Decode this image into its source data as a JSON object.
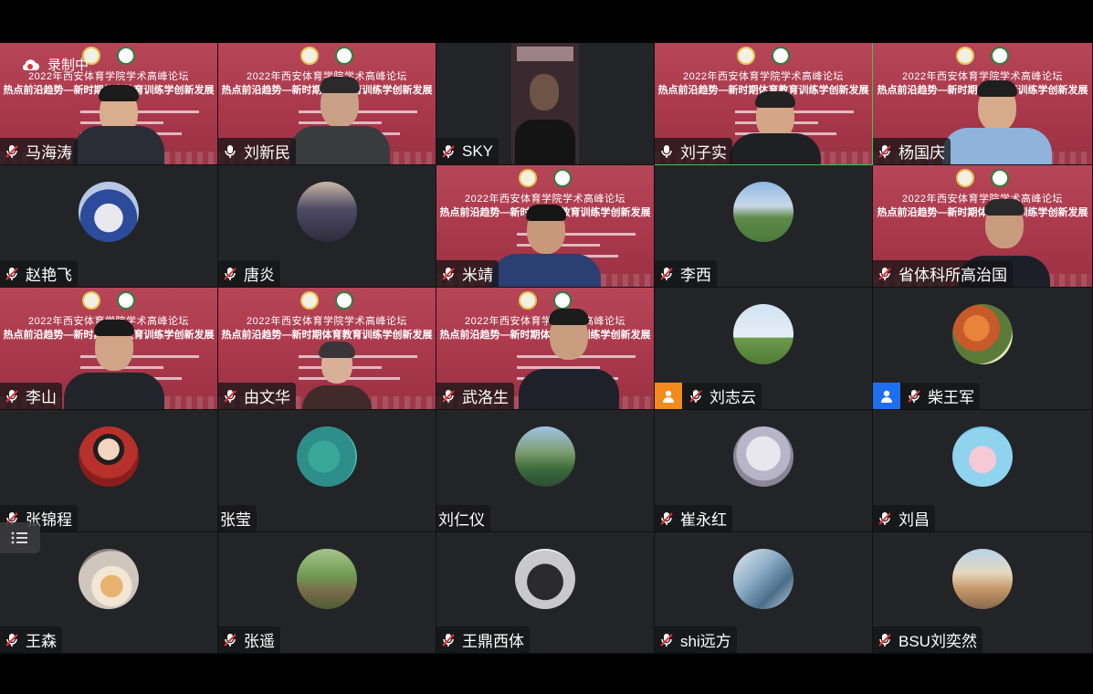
{
  "recording": {
    "label": "录制中",
    "icon": "cloud-recording-icon"
  },
  "banner": {
    "title": "2022年西安体育学院学术高峰论坛",
    "subtitle": "热点前沿趋势—新时期体育教育训练学创新发展"
  },
  "participants": [
    {
      "name": "马海涛",
      "muted": true,
      "video": "banner-person"
    },
    {
      "name": "刘新民",
      "muted": false,
      "video": "banner-person"
    },
    {
      "name": "SKY",
      "muted": true,
      "video": "dark-person"
    },
    {
      "name": "刘子实",
      "muted": false,
      "video": "banner-person",
      "active_speaker": true
    },
    {
      "name": "杨国庆",
      "muted": true,
      "video": "banner-person"
    },
    {
      "name": "赵艳飞",
      "muted": true,
      "video": "avatar"
    },
    {
      "name": "唐炎",
      "muted": true,
      "video": "avatar"
    },
    {
      "name": "米靖",
      "muted": true,
      "video": "banner-person"
    },
    {
      "name": "李西",
      "muted": true,
      "video": "avatar"
    },
    {
      "name": "省体科所高治国",
      "muted": true,
      "video": "banner-person"
    },
    {
      "name": "李山",
      "muted": true,
      "video": "banner-person"
    },
    {
      "name": "由文华",
      "muted": true,
      "video": "banner-person"
    },
    {
      "name": "武洛生",
      "muted": true,
      "video": "banner-person"
    },
    {
      "name": "刘志云",
      "muted": true,
      "video": "avatar",
      "role": "orange-user-icon"
    },
    {
      "name": "柴王军",
      "muted": true,
      "video": "avatar",
      "role": "blue-user-icon"
    },
    {
      "name": "张锦程",
      "muted": true,
      "video": "avatar"
    },
    {
      "name": "张莹",
      "muted": null,
      "video": "avatar"
    },
    {
      "name": "刘仁仪",
      "muted": null,
      "video": "avatar"
    },
    {
      "name": "崔永红",
      "muted": true,
      "video": "avatar"
    },
    {
      "name": "刘昌",
      "muted": true,
      "video": "avatar"
    },
    {
      "name": "王森",
      "muted": true,
      "video": "avatar"
    },
    {
      "name": "张遥",
      "muted": true,
      "video": "avatar"
    },
    {
      "name": "王鼎西体",
      "muted": true,
      "video": "avatar"
    },
    {
      "name": "shi远方",
      "muted": true,
      "video": "avatar"
    },
    {
      "name": "BSU刘奕然",
      "muted": true,
      "video": "avatar"
    }
  ],
  "colors": {
    "banner": "#b23a4e",
    "tile_bg": "#232427",
    "active_border": "#2ed04f",
    "muted_red": "#e0323a"
  }
}
